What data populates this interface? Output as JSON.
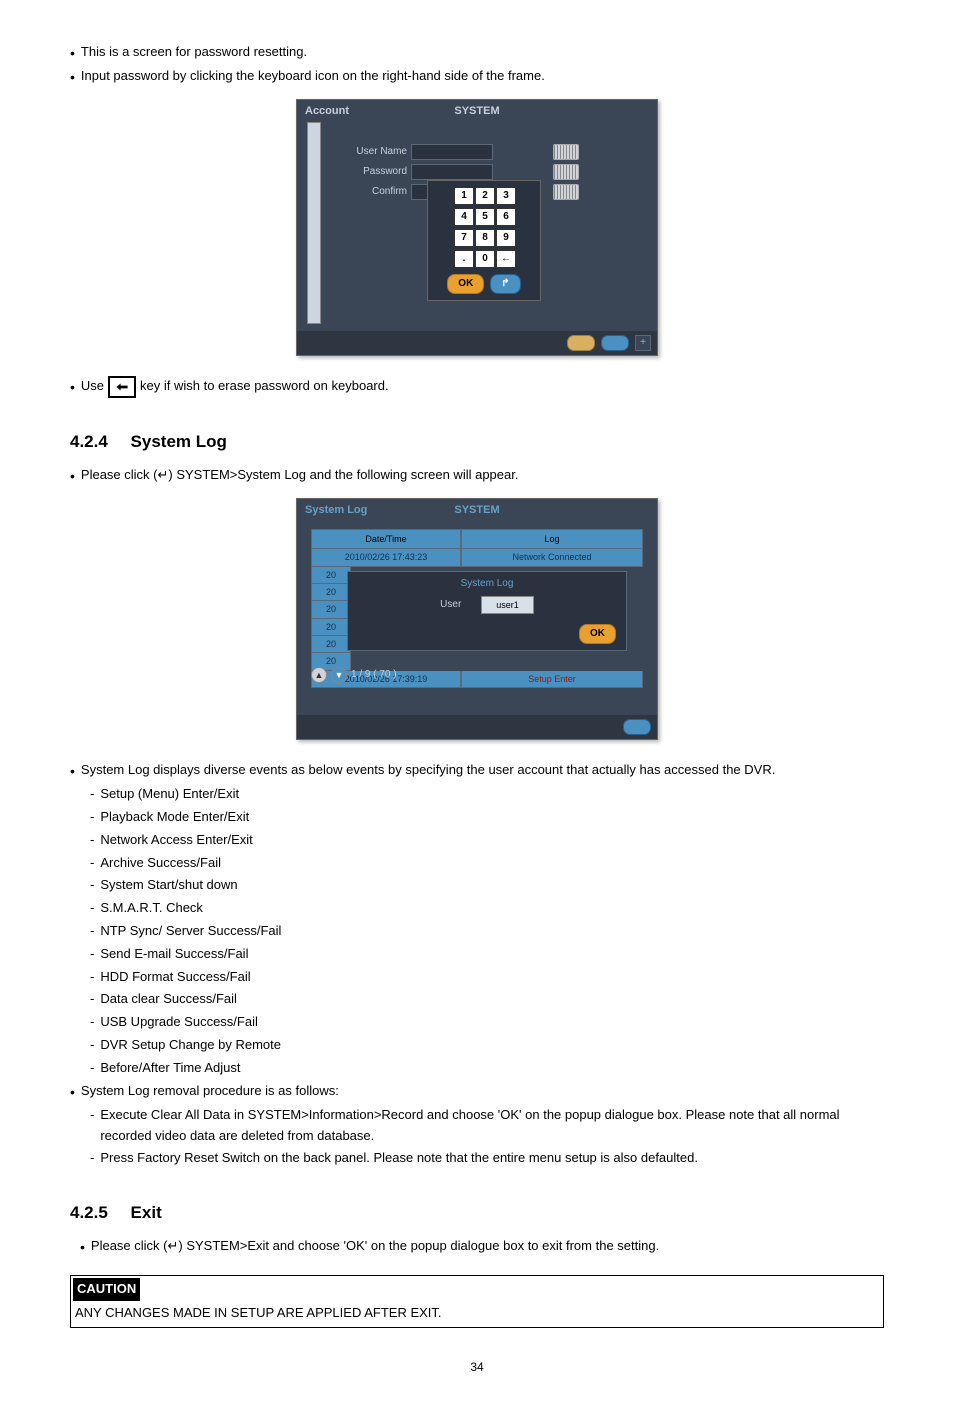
{
  "intro": {
    "line1": "This is a screen for password resetting.",
    "line2": "Input password by clicking the keyboard icon on the right-hand side of the frame."
  },
  "backspace_line": {
    "pre": "Use",
    "post": "key if wish to erase password on keyboard."
  },
  "account_ui": {
    "tab": "Account",
    "title": "SYSTEM",
    "labels": {
      "user": "User Name",
      "password": "Password",
      "confirm": "Confirm"
    },
    "keys": [
      "1",
      "2",
      "3",
      "4",
      "5",
      "6",
      "7",
      "8",
      "9",
      ".",
      "0",
      "←"
    ],
    "ok": "OK",
    "exit_icon": "↱"
  },
  "section_424": {
    "num": "4.2.4",
    "title": "System Log"
  },
  "syslog_intro": "Please click (↵) SYSTEM>System Log and the following screen will appear.",
  "syslog_ui": {
    "tab": "System Log",
    "title": "SYSTEM",
    "headers": {
      "dt": "Date/Time",
      "log": "Log"
    },
    "rows_head": {
      "dt": "2010/02/26 17:43:23",
      "log": "Network Connected"
    },
    "short_vals": [
      "20",
      "20",
      "20",
      "20",
      "20",
      "20"
    ],
    "row_last": {
      "dt": "2010/02/26 17:39:19",
      "log": "Setup Enter"
    },
    "popup": {
      "title": "System Log",
      "user_label": "User",
      "user_value": "user1",
      "ok": "OK"
    },
    "pager": "1 / 9 ( 70 )"
  },
  "syslog_desc": "System Log displays diverse events as below events by specifying the user account that actually has accessed the DVR.",
  "syslog_items": [
    "Setup (Menu) Enter/Exit",
    "Playback Mode Enter/Exit",
    "Network Access Enter/Exit",
    "Archive Success/Fail",
    "System Start/shut down",
    "S.M.A.R.T. Check",
    "NTP Sync/ Server Success/Fail",
    "Send E-mail Success/Fail",
    "HDD Format Success/Fail",
    "Data clear Success/Fail",
    "USB Upgrade Success/Fail",
    "DVR Setup Change by Remote",
    "Before/After Time Adjust"
  ],
  "removal_intro": "System Log removal procedure is as follows:",
  "removal_items": [
    "Execute Clear All Data in SYSTEM>Information>Record and choose 'OK' on the popup dialogue box. Please note that all normal recorded video data are deleted from database.",
    "Press Factory Reset Switch on the back panel. Please note that the entire menu setup is also defaulted."
  ],
  "section_425": {
    "num": "4.2.5",
    "title": "Exit"
  },
  "exit_line": "Please click (↵) SYSTEM>Exit and choose 'OK' on the popup dialogue box to exit from the setting.",
  "caution": {
    "label": "CAUTION",
    "text": "ANY CHANGES MADE IN SETUP ARE APPLIED AFTER EXIT."
  },
  "page_number": "34"
}
